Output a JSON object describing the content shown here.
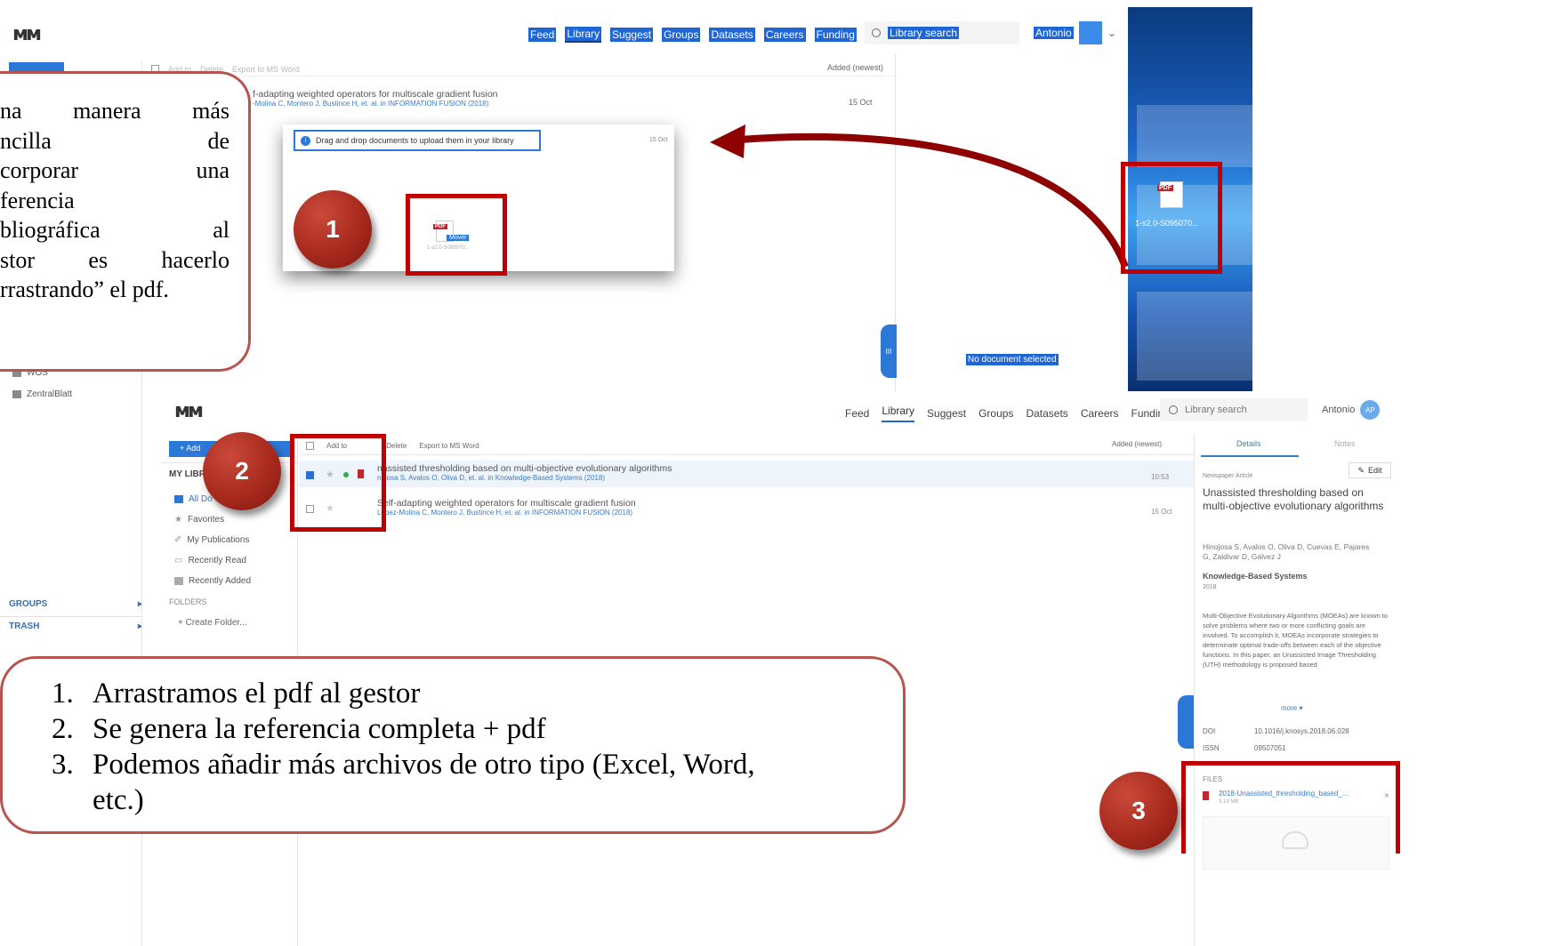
{
  "top": {
    "nav": [
      "Feed",
      "Library",
      "Suggest",
      "Groups",
      "Datasets",
      "Careers",
      "Funding"
    ],
    "search_placeholder": "Library search",
    "user": "Antonio",
    "toolbar": {
      "add_to": "Add to",
      "delete": "Delete",
      "export": "Export to MS Word",
      "sort": "Added (newest)"
    },
    "doc": {
      "title": "f-adapting weighted operators for multiscale gradient fusion",
      "authors": "-Molina C, Montero J, Bustince H, et. al. in INFORMATION FUSION (2018)",
      "date": "15 Oct"
    },
    "popup": {
      "message": "Drag and drop documents to upload them in your library",
      "date": "15 Oct",
      "mover": "Mover",
      "file": "1-s2.0-S095070..."
    },
    "desktop_file": "1-s2.0-S095070...",
    "no_doc": "No document selected",
    "side_folders": [
      "WOS",
      "ZentralBlatt"
    ]
  },
  "callout_top": {
    "lines": [
      [
        "na",
        "manera",
        "más"
      ],
      [
        "ncilla",
        "de"
      ],
      [
        "corporar",
        "una"
      ],
      [
        "ferencia"
      ],
      [
        "bliográfica",
        "al"
      ],
      [
        "stor",
        "es",
        "hacerlo"
      ],
      [
        "rrastrando” el pdf."
      ]
    ]
  },
  "bottom": {
    "nav": [
      "Feed",
      "Library",
      "Suggest",
      "Groups",
      "Datasets",
      "Careers",
      "Funding"
    ],
    "search_placeholder": "Library search",
    "user": "Antonio",
    "avatar": "AP",
    "add_button": "+ Add",
    "my_library": "MY LIBR",
    "sidebar": {
      "all_docs": "All Do",
      "favorites": "Favorites",
      "my_publications": "My Publications",
      "recently_read": "Recently Read",
      "recently_added": "Recently Added",
      "folders_heading": "FOLDERS",
      "create_folder": "+ Create Folder...",
      "groups": "GROUPS",
      "trash": "TRASH"
    },
    "toolbar": {
      "add_to": "Add to",
      "delete": "Delete",
      "export": "Export to MS Word",
      "sort": "Added (newest)"
    },
    "docs": [
      {
        "title": "nassisted thresholding based on multi-objective evolutionary algorithms",
        "authors": "nojosa S, Avalos O, Oliva D, et. al. in Knowledge-Based Systems (2018)",
        "date": "10:53"
      },
      {
        "title": "Self-adapting weighted operators for multiscale gradient fusion",
        "authors": "Lopez-Molina C, Montero J, Bustince H, et. al. in INFORMATION FUSION (2018)",
        "date": "15 Oct"
      }
    ],
    "details": {
      "tab_details": "Details",
      "tab_notes": "Notes",
      "edit": "Edit",
      "type": "Newspaper Article",
      "title": "Unassisted thresholding based on multi-objective evolutionary algorithms",
      "authors": "Hinojosa S, Avalos O, Oliva D, Cuevas E, Pajares G, Zaldivar D, Gálvez J",
      "journal": "Knowledge-Based Systems",
      "year": "2018",
      "abstract": "Multi-Objective Evolutionary Algorithms (MOEAs) are known to solve problems where two or more conflicting goals are involved. To accomplish it, MOEAs incorporate strategies to determinate optimal trade-offs between each of the objective functions. In this paper, an Unassisted Image Thresholding (UTH) methodology is proposed based",
      "more": "more",
      "doi_label": "DOI",
      "doi": "10.1016/j.knosys.2018.06.028",
      "issn_label": "ISSN",
      "issn": "09507051",
      "files_heading": "FILES",
      "file_name": "2018-Unassisted_thresholding_based_...",
      "file_size": "3.19 MB"
    }
  },
  "steps": [
    "Arrastramos el pdf al gestor",
    "Se genera la referencia completa + pdf",
    "Podemos añadir más archivos de otro tipo (Excel, Word,",
    "etc.)"
  ],
  "badges": [
    "1",
    "2",
    "3"
  ],
  "colors": {
    "accent": "#1e66d6",
    "highlight_red": "#c00000",
    "callout_border": "#b85450",
    "badge_red": "#a82a1e"
  }
}
